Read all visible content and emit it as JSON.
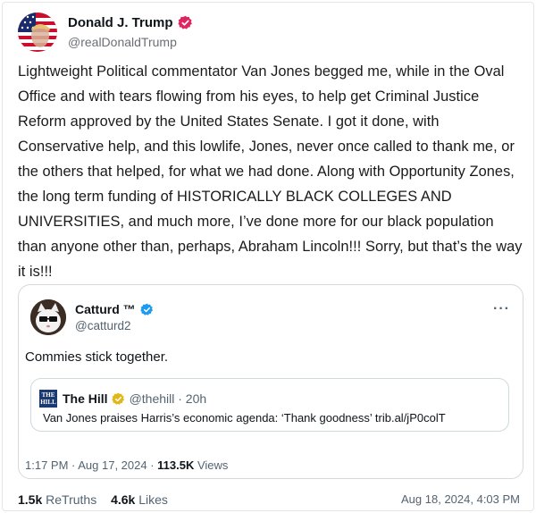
{
  "post": {
    "author_name": "Donald J. Trump",
    "author_handle": "@realDonaldTrump",
    "text": "Lightweight Political commentator Van Jones begged me, while in the Oval Office and with tears flowing from his eyes, to help get Criminal Justice Reform approved by the United States Senate. I got it done, with Conservative help, and this lowlife, Jones, never once called to thank me, or the others that helped, for what we had done. Along with Opportunity Zones, the long term funding of HISTORICALLY BLACK COLLEGES AND UNIVERSITIES, and much more, I’ve done more for our black population than anyone other than, perhaps, Abraham Lincoln!!! Sorry, but that’s the way it is!!!",
    "retruths_count": "1.5k",
    "retruths_label": "ReTruths",
    "likes_count": "4.6k",
    "likes_label": "Likes",
    "date": "Aug 18, 2024, 4:03 PM"
  },
  "quote": {
    "author_name": "Catturd ™",
    "author_handle": "@catturd2",
    "more_label": "···",
    "text": "Commies stick together.",
    "timestamp": "1:17 PM · Aug 17, 2024 · ",
    "views_count": "113.5K",
    "views_label": " Views",
    "inner": {
      "logo_text_1": "THE",
      "logo_text_2": "HILL",
      "author_name": "The Hill",
      "author_handle": "@thehill · 20h",
      "text": "Van Jones praises Harris’s economic agenda: ‘Thank goodness’ trib.al/jP0colT"
    }
  },
  "colors": {
    "verified_red": "#e0245e",
    "verified_blue": "#1d9bf0",
    "verified_gold": "#e2b719"
  }
}
